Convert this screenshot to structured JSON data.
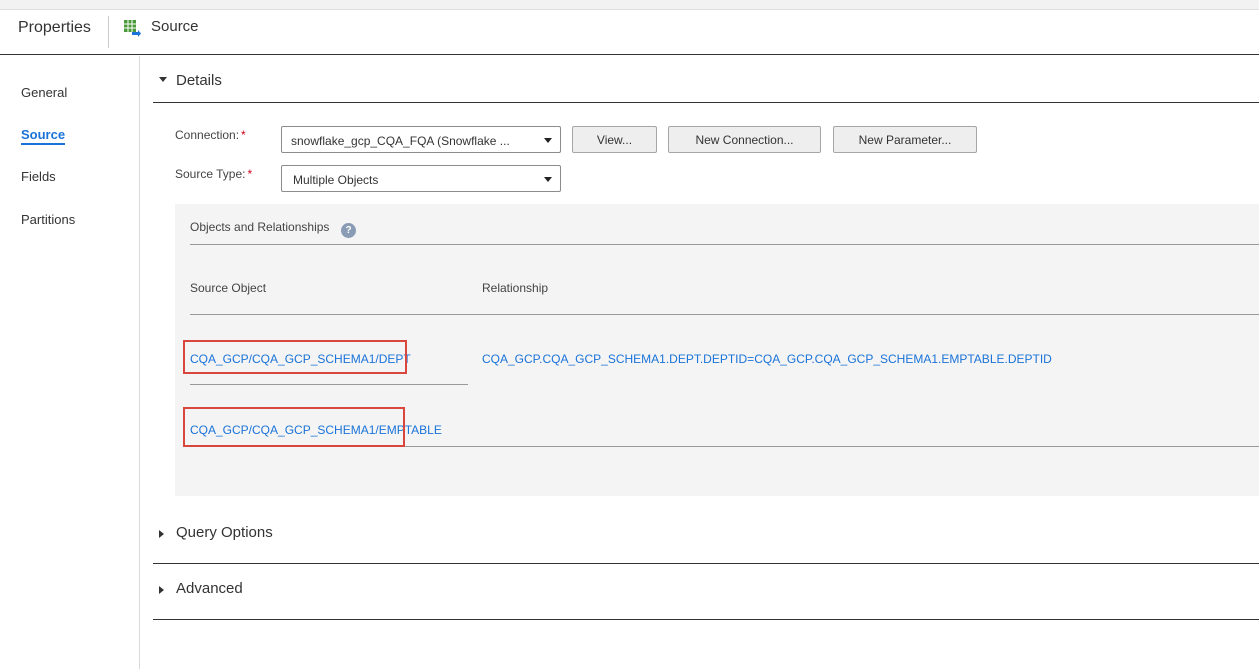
{
  "header": {
    "title": "Properties",
    "source_label": "Source"
  },
  "nav": {
    "items": [
      {
        "label": "General"
      },
      {
        "label": "Source"
      },
      {
        "label": "Fields"
      },
      {
        "label": "Partitions"
      }
    ],
    "active": "Source"
  },
  "details": {
    "title": "Details",
    "connection_label": "Connection:",
    "connection_value": "snowflake_gcp_CQA_FQA (Snowflake ...",
    "source_type_label": "Source Type:",
    "source_type_value": "Multiple Objects",
    "required_marker": "*",
    "buttons": {
      "view": "View...",
      "new_connection": "New Connection...",
      "new_parameter": "New Parameter..."
    }
  },
  "objects_panel": {
    "title": "Objects and Relationships",
    "help_glyph": "?",
    "columns": {
      "source_object": "Source Object",
      "relationship": "Relationship"
    },
    "rows": [
      {
        "source_object": "CQA_GCP/CQA_GCP_SCHEMA1/DEPT",
        "relationship": "CQA_GCP.CQA_GCP_SCHEMA1.DEPT.DEPTID=CQA_GCP.CQA_GCP_SCHEMA1.EMPTABLE.DEPTID"
      },
      {
        "source_object": "CQA_GCP/CQA_GCP_SCHEMA1/EMPTABLE",
        "relationship": ""
      }
    ]
  },
  "sections": {
    "query_options": "Query Options",
    "advanced": "Advanced"
  },
  "colors": {
    "link": "#1a73d9",
    "highlight": "#d9463e",
    "required": "#d0021b"
  }
}
